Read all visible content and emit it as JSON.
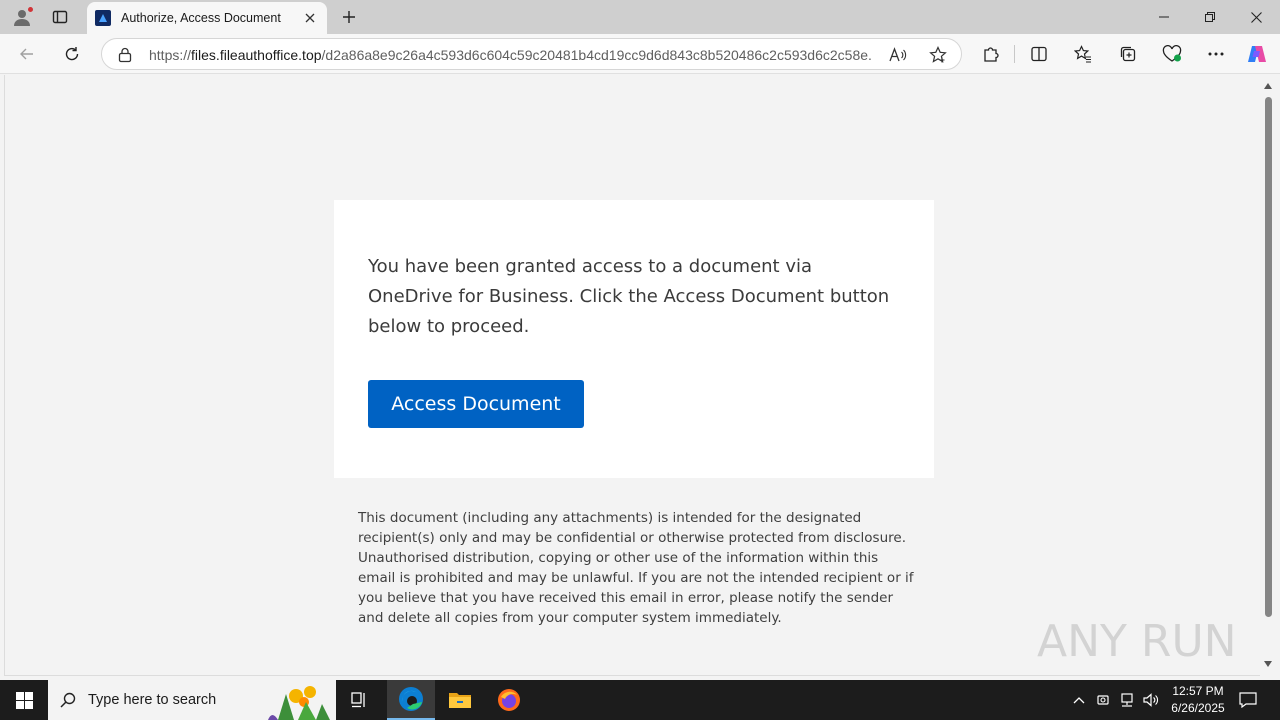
{
  "browser": {
    "tab": {
      "title": "Authorize, Access Document"
    },
    "address": {
      "scheme": "https://",
      "host": "files.fileauthoffice.top",
      "path": "/d2a86a8e9c26a4c593d6c604c59c20481b4cd19cc9d6d843c8b520486c2c593d6c2c58e..."
    }
  },
  "page": {
    "message": "You have been granted access to a document via OneDrive for Business. Click the Access Document button below to proceed.",
    "button_label": "Access Document",
    "disclaimer": "This document (including any attachments) is intended for the designated recipient(s) only and may be confidential or otherwise protected from disclosure. Unauthorised distribution, copying or other use of the information within this email is prohibited and may be unlawful. If you are not the intended recipient or if you believe that you have received this email in error, please notify the sender and delete all copies from your computer system immediately.",
    "watermark": "ANY RUN"
  },
  "taskbar": {
    "search_placeholder": "Type here to search",
    "time": "12:57 PM",
    "date": "6/26/2025"
  },
  "colors": {
    "accent_button": "#0062c3",
    "tabstrip": "#cfcfcf",
    "taskbar": "#1c1c1c"
  }
}
